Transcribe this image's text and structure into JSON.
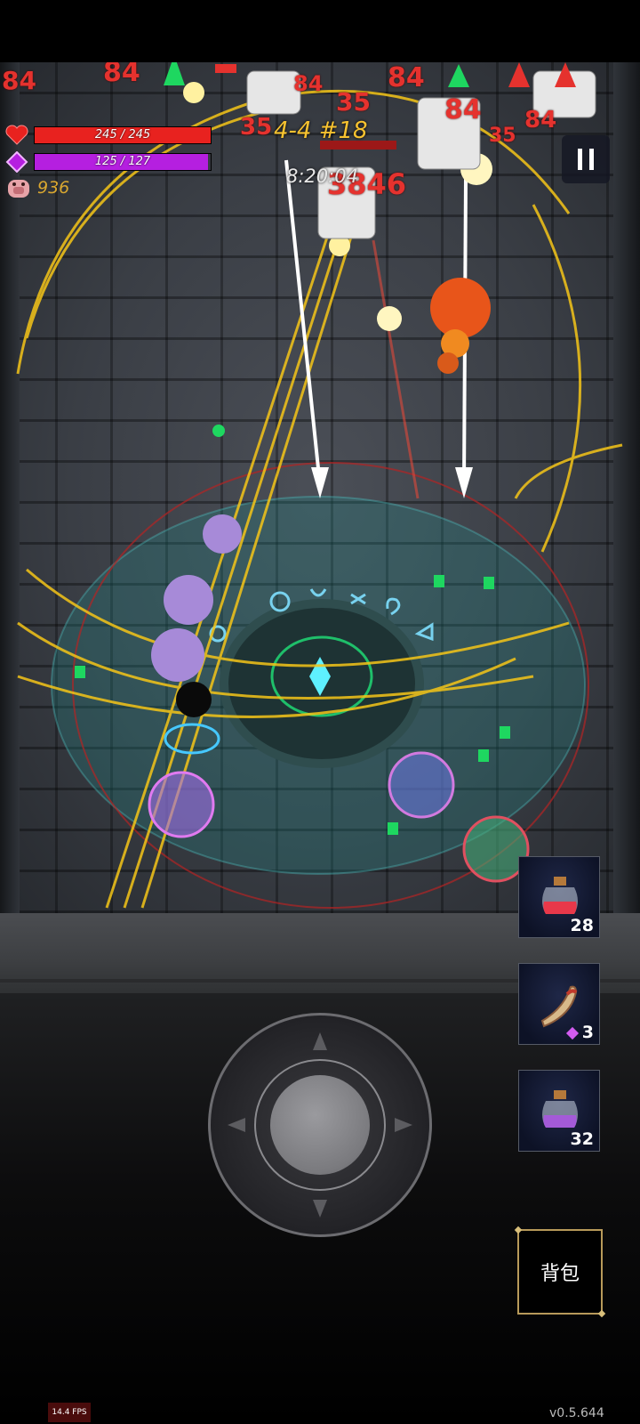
{
  "hud": {
    "hp": {
      "current": 245,
      "max": 245,
      "text": "245 / 245",
      "color": "#e8221f"
    },
    "mp": {
      "current": 125,
      "max": 127,
      "text": "125 / 127",
      "color": "#b51fe0"
    },
    "pig_value": "936"
  },
  "stage": {
    "label": "4-4 #18",
    "timer": "8:20:04"
  },
  "damage_numbers": [
    "84",
    "84",
    "84",
    "35",
    "35",
    "35",
    "84",
    "84",
    "84",
    "3846"
  ],
  "items": [
    {
      "name": "red-potion",
      "count": "28"
    },
    {
      "name": "horn",
      "count": "3",
      "currency_icon": "gem-icon"
    },
    {
      "name": "purple-potion",
      "count": "32"
    }
  ],
  "bag_button": {
    "label": "背包"
  },
  "fps": "14.4 FPS",
  "version": "v0.5.644",
  "colors": {
    "spell_gold": "#f5c518",
    "aura_teal": "#1f8a88",
    "enemy_marker": "#1ed760"
  }
}
